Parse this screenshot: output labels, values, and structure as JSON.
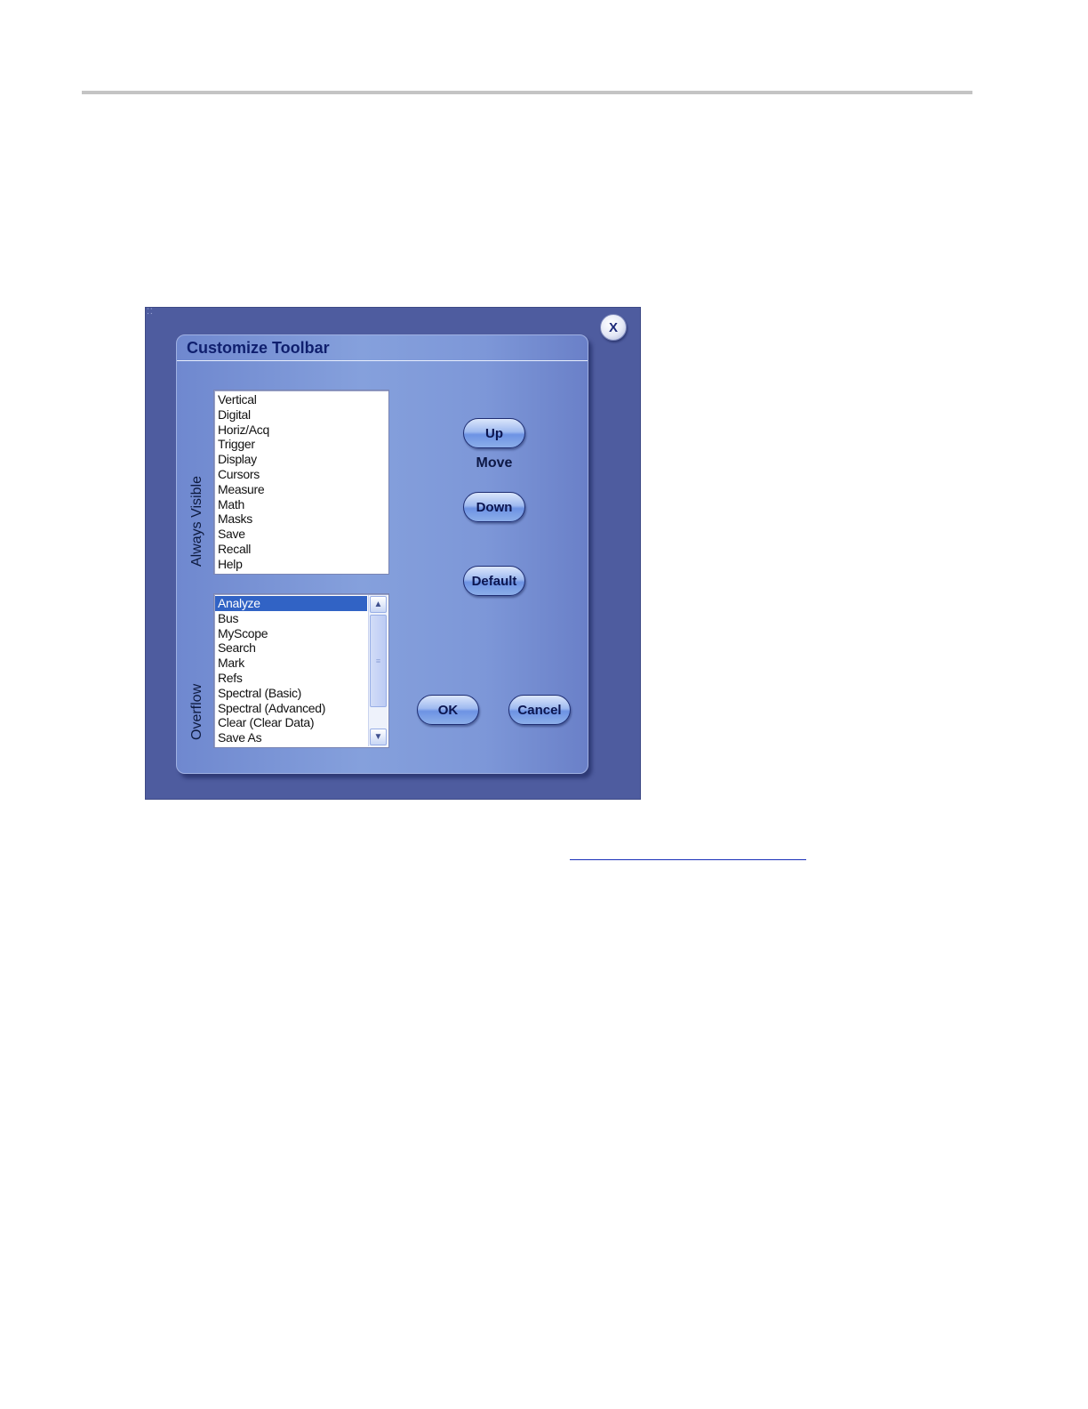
{
  "dialog": {
    "title": "Customize Toolbar",
    "close_label": "X",
    "always_visible": {
      "label": "Always Visible",
      "items": [
        "Vertical",
        "Digital",
        "Horiz/Acq",
        "Trigger",
        "Display",
        "Cursors",
        "Measure",
        "Math",
        "Masks",
        "Save",
        "Recall",
        "Help"
      ]
    },
    "overflow": {
      "label": "Overflow",
      "selected": "Analyze",
      "items": [
        "Analyze",
        "Bus",
        "MyScope",
        "Search",
        "Mark",
        "Refs",
        "Spectral (Basic)",
        "Spectral (Advanced)",
        "Clear (Clear Data)",
        "Save As"
      ]
    },
    "buttons": {
      "up": "Up",
      "move": "Move",
      "down": "Down",
      "default": "Default",
      "ok": "OK",
      "cancel": "Cancel"
    }
  },
  "colors": {
    "frame": "#4e5c9f",
    "panel": "#85a0dc",
    "title_text": "#0f1f6e",
    "selection": "#3163c5"
  }
}
